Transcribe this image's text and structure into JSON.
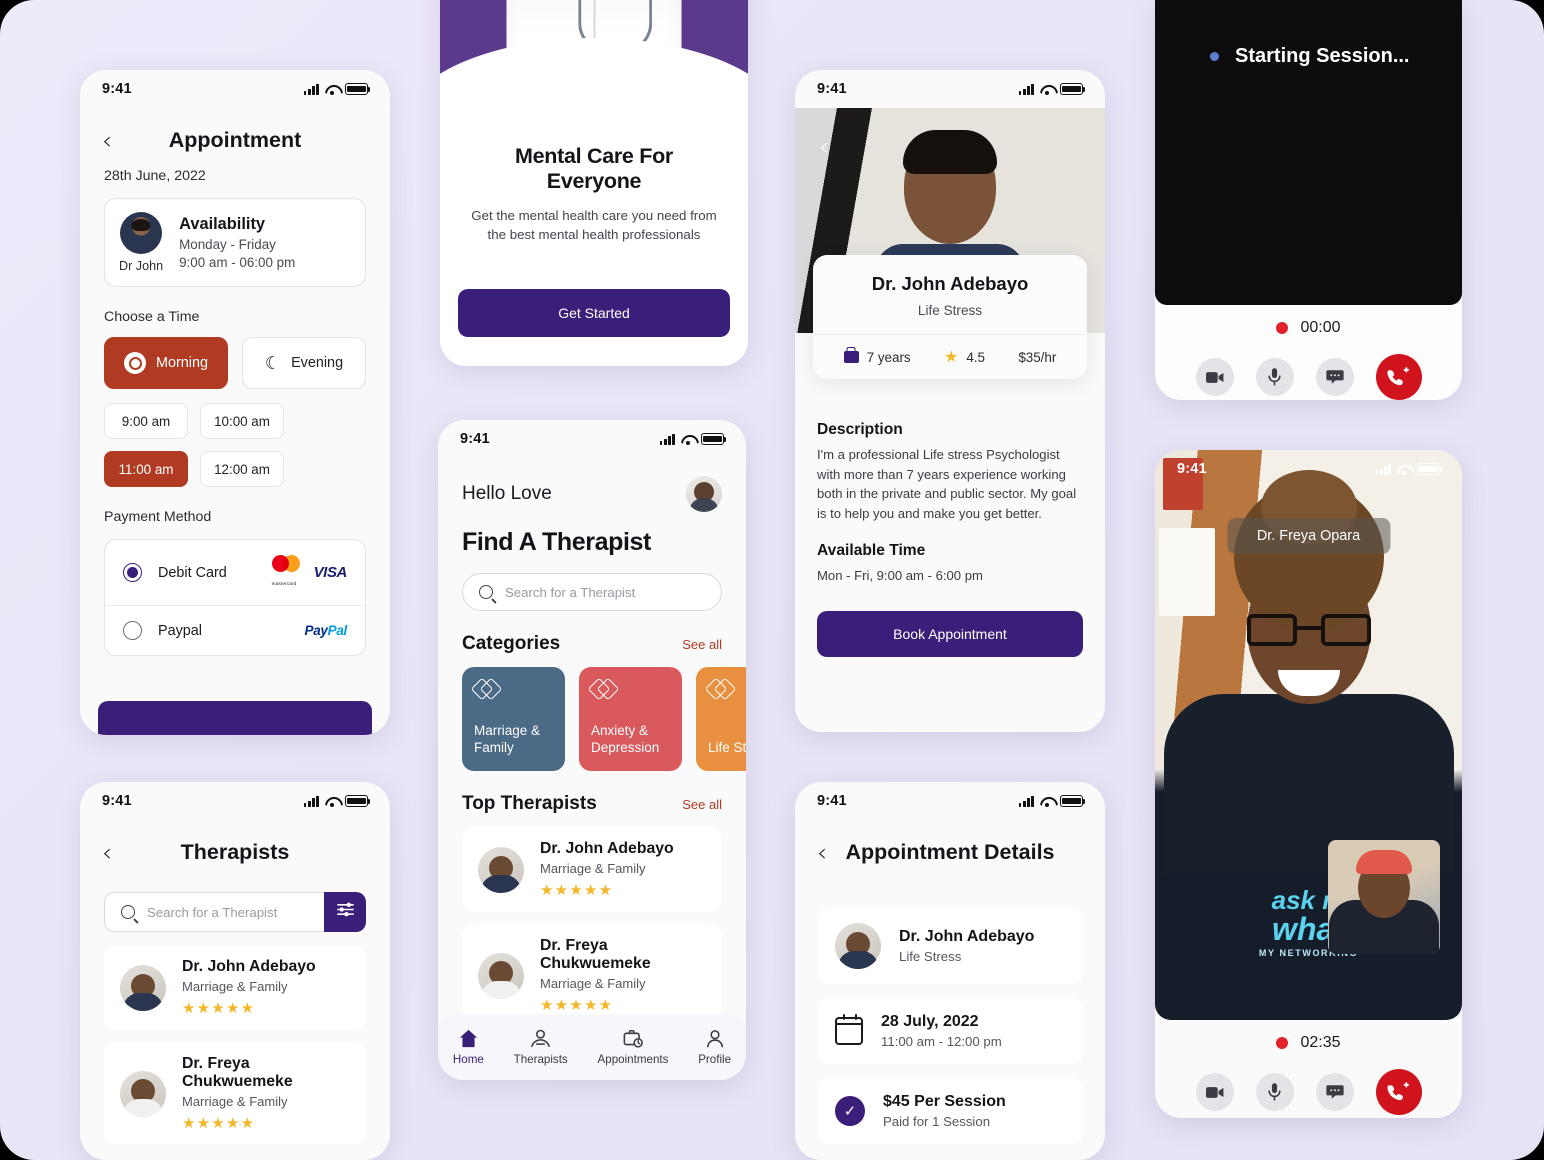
{
  "theme": {
    "purple": "#3a1f7a",
    "rust": "#b03a22",
    "star": "#f5b729",
    "red": "#d1131d",
    "bg": "#e9e5f7"
  },
  "status_bar": {
    "time": "9:41"
  },
  "appointment": {
    "title": "Appointment",
    "back_icon": "‹",
    "date": "28th June, 2022",
    "availability": {
      "doctor_name": "Dr John",
      "title": "Availability",
      "days": "Monday - Friday",
      "hours": "9:00 am - 06:00 pm"
    },
    "choose_time_label": "Choose a Time",
    "periods": [
      {
        "label": "Morning",
        "icon": "sun-icon",
        "active": true
      },
      {
        "label": "Evening",
        "icon": "moon-icon",
        "active": false
      }
    ],
    "slots": [
      {
        "label": "9:00 am",
        "active": false
      },
      {
        "label": "10:00 am",
        "active": false
      },
      {
        "label": "11:00 am",
        "active": true
      },
      {
        "label": "12:00 am",
        "active": false
      }
    ],
    "payment_label": "Payment Method",
    "payment_methods": [
      {
        "label": "Debit Card",
        "selected": true,
        "logos": "mastercard-visa"
      },
      {
        "label": "Paypal",
        "selected": false,
        "logos": "paypal"
      }
    ],
    "logos": {
      "mastercard": "mastercard",
      "visa": "VISA",
      "paypal_a": "Pay",
      "paypal_b": "Pal"
    }
  },
  "onboarding": {
    "title": "Mental Care For Everyone",
    "subtitle": "Get the mental health care you need from the best mental health professionals",
    "button": "Get Started"
  },
  "home": {
    "greeting": "Hello Love",
    "heading": "Find A Therapist",
    "search_placeholder": "Search for a Therapist",
    "categories_title": "Categories",
    "categories_see_all": "See all",
    "categories": [
      {
        "label": "Marriage & Family",
        "color": "#4b6a86"
      },
      {
        "label": "Anxiety & Depression",
        "color": "#d9595c"
      },
      {
        "label": "Life Stress",
        "color": "#e8903f"
      }
    ],
    "top_title": "Top Therapists",
    "top_see_all": "See all",
    "top_therapists": [
      {
        "name": "Dr. John Adebayo",
        "specialty": "Marriage & Family",
        "stars": "★★★★★"
      },
      {
        "name": "Dr. Freya Chukwuemeke",
        "specialty": "Marriage & Family",
        "stars": "★★★★★"
      }
    ],
    "tabs": [
      {
        "label": "Home",
        "icon": "home-icon",
        "active": true
      },
      {
        "label": "Therapists",
        "icon": "people-icon",
        "active": false
      },
      {
        "label": "Appointments",
        "icon": "briefcase-clock-icon",
        "active": false
      },
      {
        "label": "Profile",
        "icon": "person-icon",
        "active": false
      }
    ]
  },
  "therapists_screen": {
    "title": "Therapists",
    "search_placeholder": "Search for a Therapist",
    "filter_icon": "sliders-icon",
    "list": [
      {
        "name": "Dr. John Adebayo",
        "specialty": "Marriage & Family",
        "stars": "★★★★★"
      },
      {
        "name": "Dr. Freya Chukwuemeke",
        "specialty": "Marriage & Family",
        "stars": "★★★★★"
      }
    ]
  },
  "detail": {
    "name": "Dr. John Adebayo",
    "specialty": "Life Stress",
    "experience": "7 years",
    "rating": "4.5",
    "rate": "$35/hr",
    "description_title": "Description",
    "description": "I'm a professional Life stress Psychologist with more than 7 years experience working both in the private and public sector. My goal is to help you and make you get better.",
    "available_title": "Available Time",
    "available_time": "Mon - Fri, 9:00 am - 6:00 pm",
    "button": "Book Appointment"
  },
  "appointment_details": {
    "title": "Appointment Details",
    "therapist": {
      "name": "Dr. John Adebayo",
      "specialty": "Life Stress"
    },
    "schedule": {
      "date": "28 July, 2022",
      "time": "11:00 am - 12:00 pm"
    },
    "payment": {
      "amount": "$45 Per Session",
      "note": "Paid for 1 Session"
    }
  },
  "call_starting": {
    "status": "Starting Session...",
    "timer": "00:00",
    "controls": [
      "video-icon",
      "mic-icon",
      "chat-icon",
      "end-call-icon"
    ]
  },
  "call_active": {
    "participant": "Dr. Freya Opara",
    "timer": "02:35",
    "shirt_line1": "ask m",
    "shirt_line2": "what",
    "shirt_line3": "MY NETWORKING",
    "controls": [
      "video-icon",
      "mic-icon",
      "chat-icon",
      "end-call-icon"
    ]
  }
}
